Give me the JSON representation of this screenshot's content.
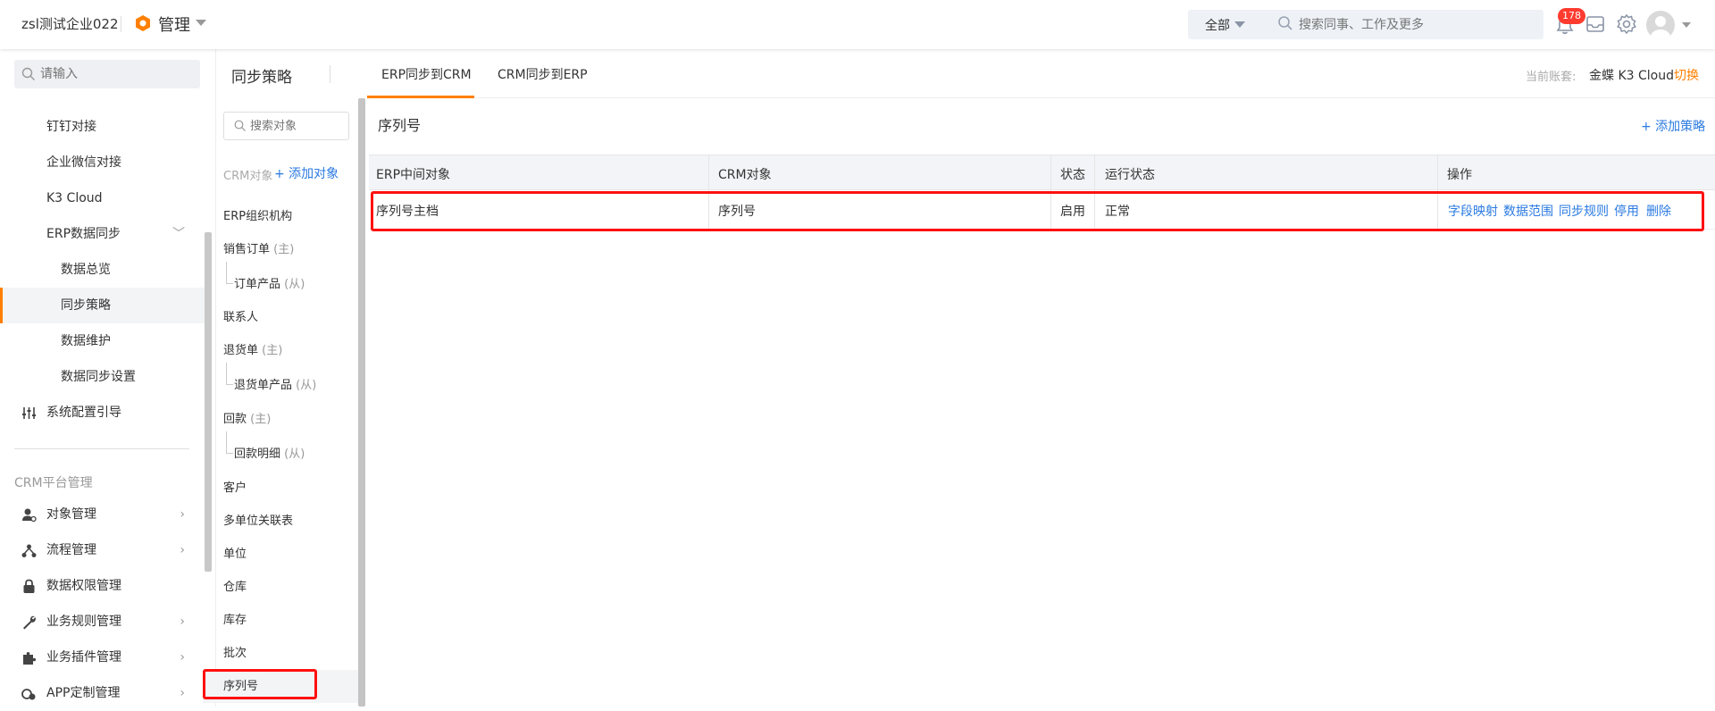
{
  "header": {
    "company": "zsl测试企业022",
    "app_title": "管理",
    "search_scope": "全部",
    "search_placeholder": "搜索同事、工作及更多",
    "notification_count": "178"
  },
  "sidebar": {
    "search_placeholder": "请输入",
    "items": [
      {
        "label": "钉钉对接"
      },
      {
        "label": "企业微信对接"
      },
      {
        "label": "K3 Cloud"
      },
      {
        "label": "ERP数据同步"
      },
      {
        "label": "数据总览"
      },
      {
        "label": "同步策略"
      },
      {
        "label": "数据维护"
      },
      {
        "label": "数据同步设置"
      },
      {
        "label": "系统配置引导"
      }
    ],
    "crm_section": "CRM平台管理",
    "crm_items": [
      {
        "label": "对象管理"
      },
      {
        "label": "流程管理"
      },
      {
        "label": "数据权限管理"
      },
      {
        "label": "业务规则管理"
      },
      {
        "label": "业务插件管理"
      },
      {
        "label": "APP定制管理"
      }
    ]
  },
  "objects": {
    "title": "同步策略",
    "search_placeholder": "搜索对象",
    "crm_label": "CRM对象",
    "add_label": "+ 添加对象",
    "items": [
      {
        "label": "ERP组织机构",
        "sub": ""
      },
      {
        "label": "销售订单",
        "sub": "(主)"
      },
      {
        "label": "订单产品",
        "sub": "(从)"
      },
      {
        "label": "联系人",
        "sub": ""
      },
      {
        "label": "退货单",
        "sub": "(主)"
      },
      {
        "label": "退货单产品",
        "sub": "(从)"
      },
      {
        "label": "回款",
        "sub": "(主)"
      },
      {
        "label": "回款明细",
        "sub": "(从)"
      },
      {
        "label": "客户",
        "sub": ""
      },
      {
        "label": "多单位关联表",
        "sub": ""
      },
      {
        "label": "单位",
        "sub": ""
      },
      {
        "label": "仓库",
        "sub": ""
      },
      {
        "label": "库存",
        "sub": ""
      },
      {
        "label": "批次",
        "sub": ""
      },
      {
        "label": "序列号",
        "sub": ""
      }
    ]
  },
  "tabs": [
    {
      "label": "ERP同步到CRM"
    },
    {
      "label": "CRM同步到ERP"
    }
  ],
  "account": {
    "label": "当前账套:",
    "value": "金蝶 K3 Cloud",
    "switch": "切换"
  },
  "main": {
    "title": "序列号",
    "add_strategy": "+ 添加策略",
    "columns": [
      "ERP中间对象",
      "CRM对象",
      "状态",
      "运行状态",
      "操作"
    ],
    "rows": [
      {
        "erp": "序列号主档",
        "crm": "序列号",
        "status": "启用",
        "run_status": "正常",
        "actions": [
          "字段映射",
          "数据范围",
          "同步规则",
          "停用",
          "删除"
        ]
      }
    ]
  },
  "colors": {
    "accent": "#ff8000",
    "link": "#2a7ae2",
    "highlight": "#ff1010",
    "badge": "#ff3b30"
  }
}
